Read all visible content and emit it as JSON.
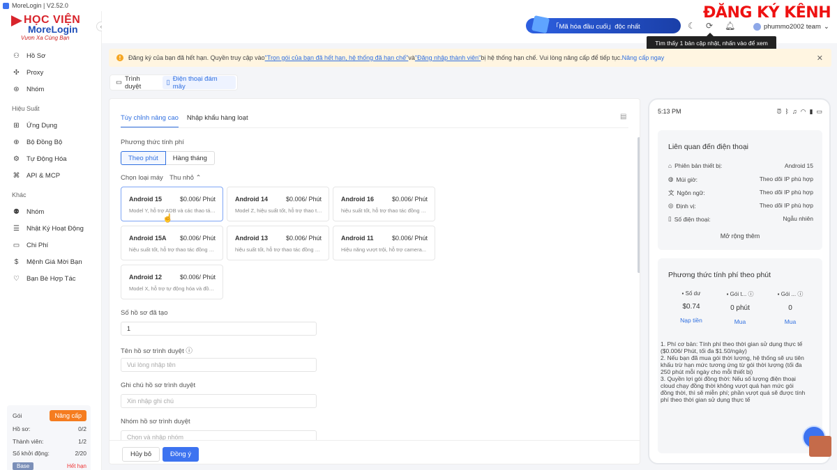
{
  "app": {
    "title": "MoreLogin | V2.52.0"
  },
  "logo": {
    "line1": "HỌC VIỆN",
    "line2": "MoreLogin",
    "slogan": "Vươn Xa Cùng Bạn"
  },
  "sidebar": {
    "items": [
      {
        "label": "Hồ Sơ",
        "icon": "profile-icon"
      },
      {
        "label": "Proxy",
        "icon": "proxy-icon"
      },
      {
        "label": "Nhóm",
        "icon": "group-icon"
      }
    ],
    "section_performance": "Hiệu Suất",
    "perf_items": [
      {
        "label": "Ứng Dụng",
        "icon": "apps-icon"
      },
      {
        "label": "Bộ Đồng Bộ",
        "icon": "sync-icon"
      },
      {
        "label": "Tự Động Hóa",
        "icon": "automation-icon"
      },
      {
        "label": "API & MCP",
        "icon": "api-icon"
      }
    ],
    "section_other": "Khác",
    "other_items": [
      {
        "label": "Nhóm",
        "icon": "team-icon"
      },
      {
        "label": "Nhật Ký Hoạt Động",
        "icon": "log-icon"
      },
      {
        "label": "Chi Phí",
        "icon": "cost-icon"
      },
      {
        "label": "Mệnh Giá Mời Bạn",
        "icon": "dollar-icon"
      },
      {
        "label": "Bạn Bè Hợp Tác",
        "icon": "partner-icon"
      }
    ],
    "plan": {
      "label": "Gói",
      "upgrade": "Nâng cấp",
      "profiles_label": "Hồ sơ:",
      "profiles_value": "0/2",
      "members_label": "Thành viên:",
      "members_value": "1/2",
      "launches_label": "Số khởi động:",
      "launches_value": "2/20",
      "base": "Base",
      "expired": "Hết hạn"
    }
  },
  "header": {
    "banner": "「Mã hóa đầu cuối」độc nhất",
    "watermark": "ĐĂNG KÝ KÊNH",
    "user": "phummo2002 team",
    "tooltip": "Tìm thấy 1 bản cập nhật, nhấn vào để xem"
  },
  "notice": {
    "text1": "Đăng ký của bạn đã hết hạn. Quyền truy cập vào ",
    "link1": "\"Trọn gói của bạn đã hết hạn, hệ thống đã hạn chế\"",
    "text2": " và ",
    "link2": "\"Đăng nhập thành viên\"",
    "text3": " bị hệ thống hạn chế. Vui lòng nâng cấp để tiếp tục.",
    "link3": "Nâng cấp ngay"
  },
  "type_tabs": {
    "browser": "Trình duyệt",
    "cloud_phone": "Điện thoại đám mây"
  },
  "form": {
    "tabs": {
      "advanced": "Tùy chỉnh nâng cao",
      "bulk": "Nhập khẩu hàng loạt"
    },
    "billing_label": "Phương thức tính phí",
    "billing_options": {
      "per_minute": "Theo phút",
      "monthly": "Hàng tháng"
    },
    "machine_label": "Chọn loại máy",
    "collapse": "Thu nhỏ",
    "cards": [
      {
        "name": "Android 15",
        "price": "$0.006/ Phút",
        "desc": "Model Y, hỗ trợ ADB và các thao tác..."
      },
      {
        "name": "Android 14",
        "price": "$0.006/ Phút",
        "desc": "Model Z, hiệu suất tốt, hỗ trợ thao tác..."
      },
      {
        "name": "Android 16",
        "price": "$0.006/ Phút",
        "desc": "hiệu suất tốt, hỗ trợ thao tác đồng bộ..."
      },
      {
        "name": "Android 15A",
        "price": "$0.006/ Phút",
        "desc": "hiệu suất tốt, hỗ trợ thao tác đồng bộ..."
      },
      {
        "name": "Android 13",
        "price": "$0.006/ Phút",
        "desc": "hiệu suất tốt, hỗ trợ thao tác đồng bộ..."
      },
      {
        "name": "Android 11",
        "price": "$0.006/ Phút",
        "desc": "Hiệu năng vượt trội, hỗ trợ camera..."
      },
      {
        "name": "Android 12",
        "price": "$0.006/ Phút",
        "desc": "Model X, hỗ trợ tự động hóa và đồng bộ..."
      }
    ],
    "count_label": "Số hồ sơ đã tạo",
    "count_value": "1",
    "name_label": "Tên hồ sơ trình duyệt",
    "name_placeholder": "Vui lòng nhập tên",
    "note_label": "Ghi chú hồ sơ trình duyệt",
    "note_placeholder": "Xin nhập ghi chú",
    "group_label": "Nhóm hồ sơ trình duyệt",
    "group_placeholder": "Chọn và nhập nhóm",
    "cancel": "Hủy bỏ",
    "ok": "Đồng ý"
  },
  "phone": {
    "time": "5:13 PM",
    "card1_title": "Liên quan đến điện thoại",
    "rows": [
      {
        "k": "Phiên bản thiết bị:",
        "v": "Android 15"
      },
      {
        "k": "Múi giờ:",
        "v": "Theo dõi IP phù hợp"
      },
      {
        "k": "Ngôn ngữ:",
        "v": "Theo dõi IP phù hợp"
      },
      {
        "k": "Định vị:",
        "v": "Theo dõi IP phù hợp"
      },
      {
        "k": "Số điện thoại:",
        "v": "Ngẫu nhiên"
      }
    ],
    "expand": "Mở rộng thêm",
    "card2_title": "Phương thức tính phí theo phút",
    "cols": [
      {
        "t": "Số dư",
        "v": "$0.74",
        "a": "Nạp tiền"
      },
      {
        "t": "Gói t...",
        "v": "0 phút",
        "a": "Mua"
      },
      {
        "t": "Gói ...",
        "v": "0",
        "a": "Mua"
      }
    ],
    "notes": [
      "1. Phí cơ bản: Tính phí theo thời gian sử dụng thực tế ($0.006/ Phút, tối đa $1.50/ngày)",
      "2. Nếu bạn đã mua gói thời lượng, hệ thống sẽ ưu tiên khấu trừ hạn mức tương ứng từ gói thời lượng (tối đa 250 phút mỗi ngày cho mỗi thiết bị)",
      "3. Quyền lợi gói đồng thời: Nếu số lượng điện thoại cloud chạy đồng thời không vượt quá hạn mức gói đồng thời, thì sẽ miễn phí; phần vượt quá sẽ được tính phí theo thời gian sử dụng thực tế"
    ]
  }
}
